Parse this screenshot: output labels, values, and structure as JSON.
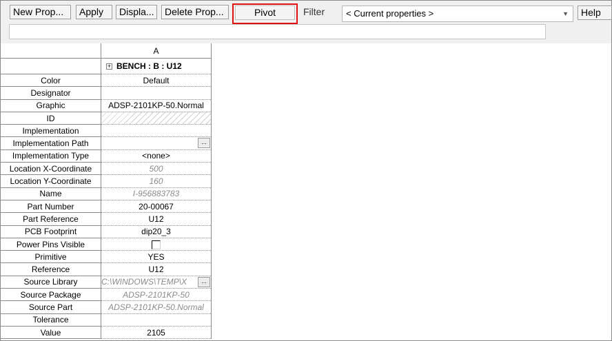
{
  "toolbar": {
    "new_prop": "New Prop...",
    "apply": "Apply",
    "display": "Displa...",
    "delete_prop": "Delete Prop...",
    "pivot": "Pivot",
    "filter_label": "Filter",
    "filter_value": "< Current properties >",
    "help": "Help"
  },
  "grid": {
    "column_header": "A",
    "part_header": "BENCH : B : U12",
    "rows": [
      {
        "name": "Color",
        "value": "Default"
      },
      {
        "name": "Designator",
        "value": ""
      },
      {
        "name": "Graphic",
        "value": "ADSP-2101KP-50.Normal"
      },
      {
        "name": "ID",
        "value": ""
      },
      {
        "name": "Implementation",
        "value": ""
      },
      {
        "name": "Implementation Path",
        "value": ""
      },
      {
        "name": "Implementation Type",
        "value": "<none>"
      },
      {
        "name": "Location X-Coordinate",
        "value": "500"
      },
      {
        "name": "Location Y-Coordinate",
        "value": "160"
      },
      {
        "name": "Name",
        "value": "I-956883783"
      },
      {
        "name": "Part Number",
        "value": "20-00067"
      },
      {
        "name": "Part Reference",
        "value": "U12"
      },
      {
        "name": "PCB Footprint",
        "value": "dip20_3"
      },
      {
        "name": "Power Pins Visible",
        "value": ""
      },
      {
        "name": "Primitive",
        "value": "YES"
      },
      {
        "name": "Reference",
        "value": "U12"
      },
      {
        "name": "Source Library",
        "value": "C:\\WINDOWS\\TEMP\\X"
      },
      {
        "name": "Source Package",
        "value": "ADSP-2101KP-50"
      },
      {
        "name": "Source Part",
        "value": "ADSP-2101KP-50.Normal"
      },
      {
        "name": "Tolerance",
        "value": ""
      },
      {
        "name": "Value",
        "value": "2105"
      }
    ],
    "ellipsis": "..."
  },
  "colors": {
    "highlight": "#e01010",
    "readonly_text": "#8a8a8a"
  }
}
